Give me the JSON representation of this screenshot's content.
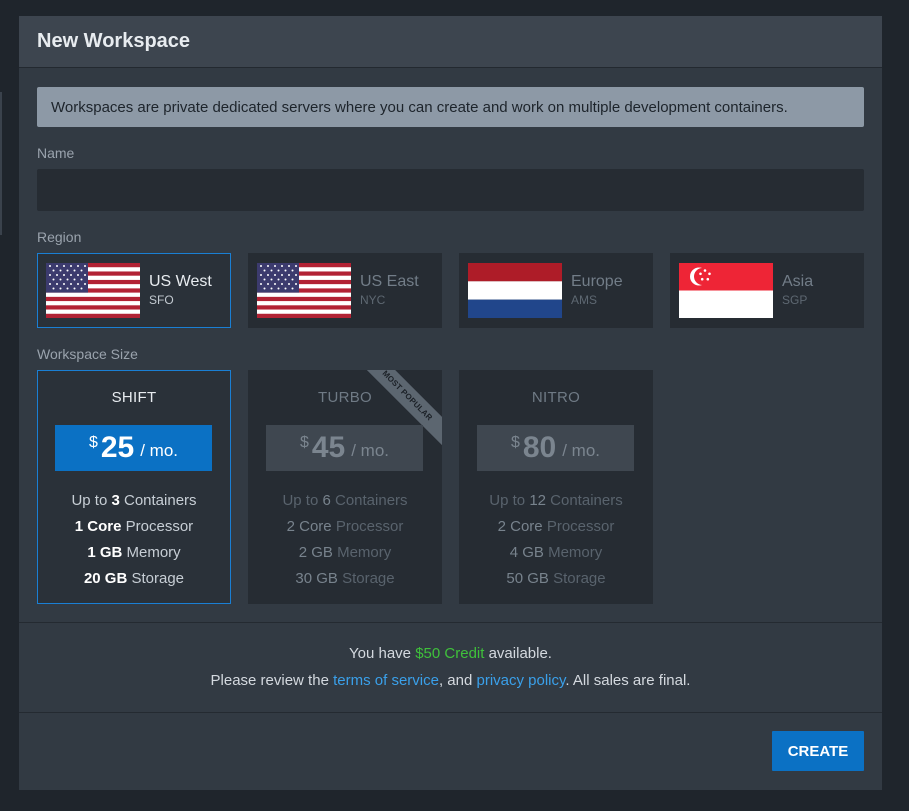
{
  "modal": {
    "title": "New Workspace",
    "info": "Workspaces are private dedicated servers where you can create and work on multiple development containers."
  },
  "name_field": {
    "label": "Name",
    "value": "",
    "placeholder": ""
  },
  "region": {
    "label": "Region",
    "options": [
      {
        "name": "US West",
        "code": "SFO",
        "flag": "us-flag",
        "selected": true
      },
      {
        "name": "US East",
        "code": "NYC",
        "flag": "us-flag",
        "selected": false
      },
      {
        "name": "Europe",
        "code": "AMS",
        "flag": "netherlands-flag",
        "selected": false
      },
      {
        "name": "Asia",
        "code": "SGP",
        "flag": "singapore-flag",
        "selected": false
      }
    ]
  },
  "size": {
    "label": "Workspace Size",
    "options": [
      {
        "name": "SHIFT",
        "currency": "$",
        "price": "25",
        "unit": "/ mo.",
        "selected": true,
        "specs": {
          "containers": {
            "pre": "Up to ",
            "num": "3",
            "post": " Containers"
          },
          "processor": {
            "num": "1 Core",
            "post": " Processor"
          },
          "memory": {
            "num": "1 GB",
            "post": " Memory"
          },
          "storage": {
            "num": "20 GB",
            "post": " Storage"
          }
        }
      },
      {
        "name": "TURBO",
        "currency": "$",
        "price": "45",
        "unit": "/ mo.",
        "selected": false,
        "ribbon": "MOST POPULAR",
        "specs": {
          "containers": {
            "pre": "Up to ",
            "num": "6",
            "post": " Containers"
          },
          "processor": {
            "num": "2 Core",
            "post": " Processor"
          },
          "memory": {
            "num": "2 GB",
            "post": " Memory"
          },
          "storage": {
            "num": "30 GB",
            "post": " Storage"
          }
        }
      },
      {
        "name": "NITRO",
        "currency": "$",
        "price": "80",
        "unit": "/ mo.",
        "selected": false,
        "specs": {
          "containers": {
            "pre": "Up to ",
            "num": "12",
            "post": " Containers"
          },
          "processor": {
            "num": "2 Core",
            "post": " Processor"
          },
          "memory": {
            "num": "4 GB",
            "post": " Memory"
          },
          "storage": {
            "num": "50 GB",
            "post": " Storage"
          }
        }
      }
    ]
  },
  "footer": {
    "credit_pre": "You have ",
    "credit_amount": "$50 Credit",
    "credit_post": " available.",
    "terms_pre": "Please review the ",
    "terms_link": "terms of service",
    "terms_mid": ", and ",
    "privacy_link": "privacy policy",
    "terms_post": ". All sales are final."
  },
  "create_label": "CREATE",
  "colors": {
    "accent": "#0b71c4",
    "credit": "#3fc13b",
    "link": "#3aa0ea"
  }
}
